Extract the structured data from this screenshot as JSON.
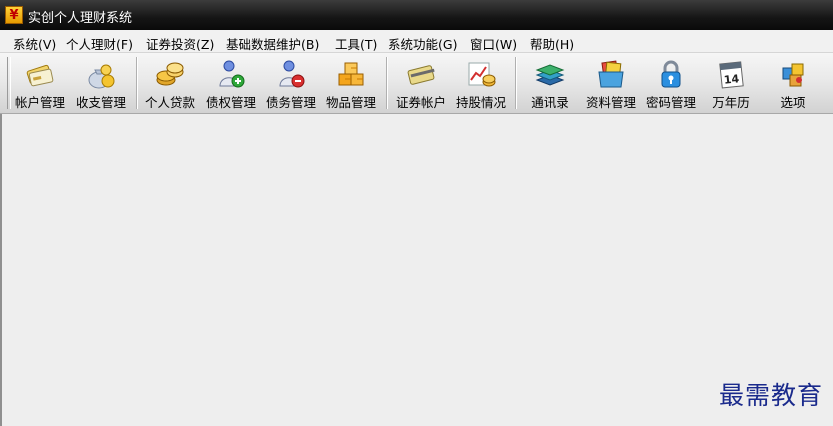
{
  "window": {
    "title": "实创个人理财系统",
    "icon": "yuan-icon",
    "icon_glyph": "¥"
  },
  "menu": [
    {
      "label": "系统(V)"
    },
    {
      "label": "个人理财(F)"
    },
    {
      "label": "证券投资(Z)"
    },
    {
      "label": "基础数据维护(B)"
    },
    {
      "label": "工具(T)"
    },
    {
      "label": "系统功能(G)"
    },
    {
      "label": "窗口(W)"
    },
    {
      "label": "帮助(H)"
    }
  ],
  "toolbar": [
    {
      "label": "帐户管理",
      "icon": "account-card-icon"
    },
    {
      "label": "收支管理",
      "icon": "money-bag-icon"
    },
    {
      "label": "个人贷款",
      "icon": "coins-icon"
    },
    {
      "label": "债权管理",
      "icon": "user-plus-icon"
    },
    {
      "label": "债务管理",
      "icon": "user-minus-icon"
    },
    {
      "label": "物品管理",
      "icon": "boxes-icon"
    },
    {
      "label": "证券帐户",
      "icon": "securities-card-icon"
    },
    {
      "label": "持股情况",
      "icon": "stock-chart-icon"
    },
    {
      "label": "通讯录",
      "icon": "address-book-icon"
    },
    {
      "label": "资料管理",
      "icon": "file-box-icon"
    },
    {
      "label": "密码管理",
      "icon": "lock-icon"
    },
    {
      "label": "万年历",
      "icon": "calendar-icon",
      "icon_text": "14"
    },
    {
      "label": "选项",
      "icon": "options-icon"
    }
  ],
  "watermark": "最需教育"
}
